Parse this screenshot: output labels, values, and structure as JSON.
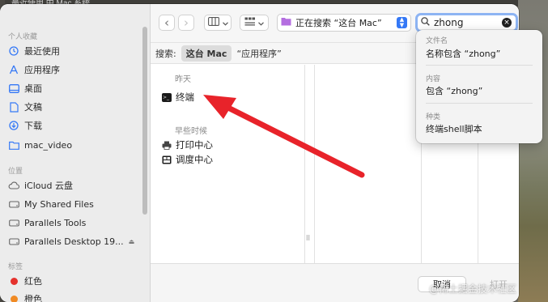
{
  "background": {
    "title_fragment": "最近使用 中 Mac 系统",
    "accent": "#3478f6",
    "arrow_color": "#e8232a"
  },
  "sidebar": {
    "sections": [
      {
        "label": "个人收藏",
        "items": [
          {
            "label": "最近使用",
            "icon": "clock-icon"
          },
          {
            "label": "应用程序",
            "icon": "apps-icon"
          },
          {
            "label": "桌面",
            "icon": "desktop-icon"
          },
          {
            "label": "文稿",
            "icon": "document-icon"
          },
          {
            "label": "下载",
            "icon": "download-icon"
          },
          {
            "label": "mac_video",
            "icon": "folder-icon"
          }
        ]
      },
      {
        "label": "位置",
        "items": [
          {
            "label": "iCloud 云盘",
            "icon": "cloud-icon"
          },
          {
            "label": "My Shared Files",
            "icon": "drive-icon"
          },
          {
            "label": "Parallels Tools",
            "icon": "drive-icon"
          },
          {
            "label": "Parallels Desktop 19...",
            "icon": "drive-icon",
            "eject": "⏏"
          }
        ]
      },
      {
        "label": "标签",
        "items": [
          {
            "label": "红色",
            "color": "#e5322d"
          },
          {
            "label": "橙色",
            "color": "#f08a24"
          }
        ]
      }
    ]
  },
  "toolbar": {
    "back": "‹",
    "forward": "›",
    "location": "正在搜索 “这台 Mac”",
    "search_value": "zhong"
  },
  "scope": {
    "label": "搜索:",
    "active": "这台 Mac",
    "other": "“应用程序”"
  },
  "results": {
    "group1_header": "昨天",
    "group1": [
      {
        "label": "终端",
        "icon": "terminal-icon"
      }
    ],
    "group2_header": "早些时候",
    "group2": [
      {
        "label": "打印中心",
        "icon": "printer-icon"
      },
      {
        "label": "调度中心",
        "icon": "mission-control-icon"
      }
    ]
  },
  "suggestions": [
    {
      "header": "文件名",
      "item": "名称包含 “zhong”"
    },
    {
      "header": "内容",
      "item": "包含 “zhong”"
    },
    {
      "header": "种类",
      "item": "终端shell脚本"
    }
  ],
  "buttons": {
    "cancel": "取消",
    "open": "打开"
  },
  "watermark": "@稀土掘金技术社区"
}
